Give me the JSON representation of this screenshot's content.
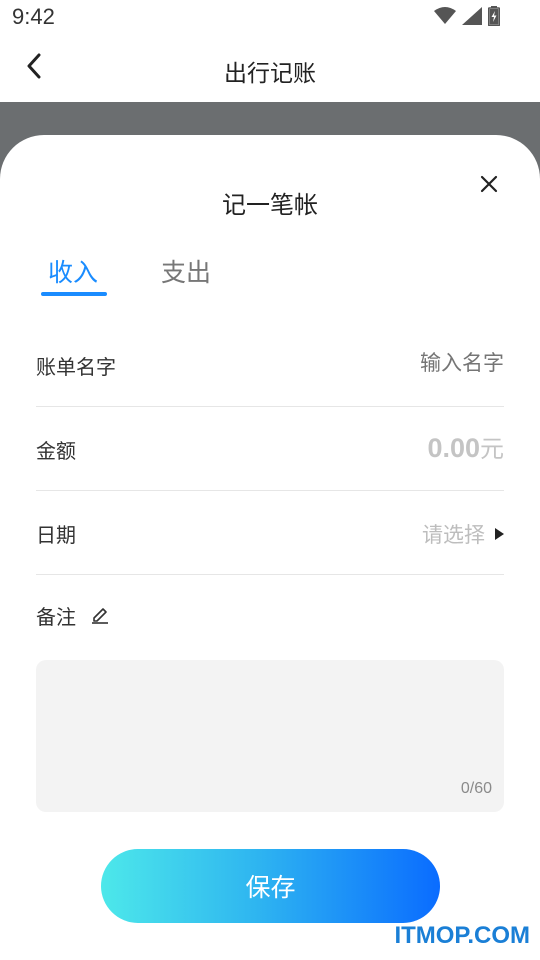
{
  "status_bar": {
    "time": "9:42",
    "icons": [
      "wifi-icon",
      "signal-icon",
      "battery-charging-icon"
    ]
  },
  "header": {
    "title": "出行记账",
    "back_icon": "chevron-left-icon"
  },
  "sheet": {
    "title": "记一笔帐",
    "close_icon": "close-icon",
    "tabs": [
      {
        "label": "收入",
        "active": true
      },
      {
        "label": "支出",
        "active": false
      }
    ],
    "fields": {
      "name": {
        "label": "账单名字",
        "placeholder": "输入名字"
      },
      "amount": {
        "label": "金额",
        "value": "0.00",
        "unit": "元"
      },
      "date": {
        "label": "日期",
        "placeholder": "请选择"
      }
    },
    "note": {
      "label": "备注",
      "counter": "0/60"
    },
    "save_label": "保存"
  },
  "watermark": "ITMOP.COM",
  "colors": {
    "accent": "#1a8cff",
    "overlay": "#6b6e70",
    "gradient_start": "#4de8ea",
    "gradient_end": "#0a6cff",
    "placeholder": "#bdbdbd",
    "watermark": "#1a7fd6"
  }
}
